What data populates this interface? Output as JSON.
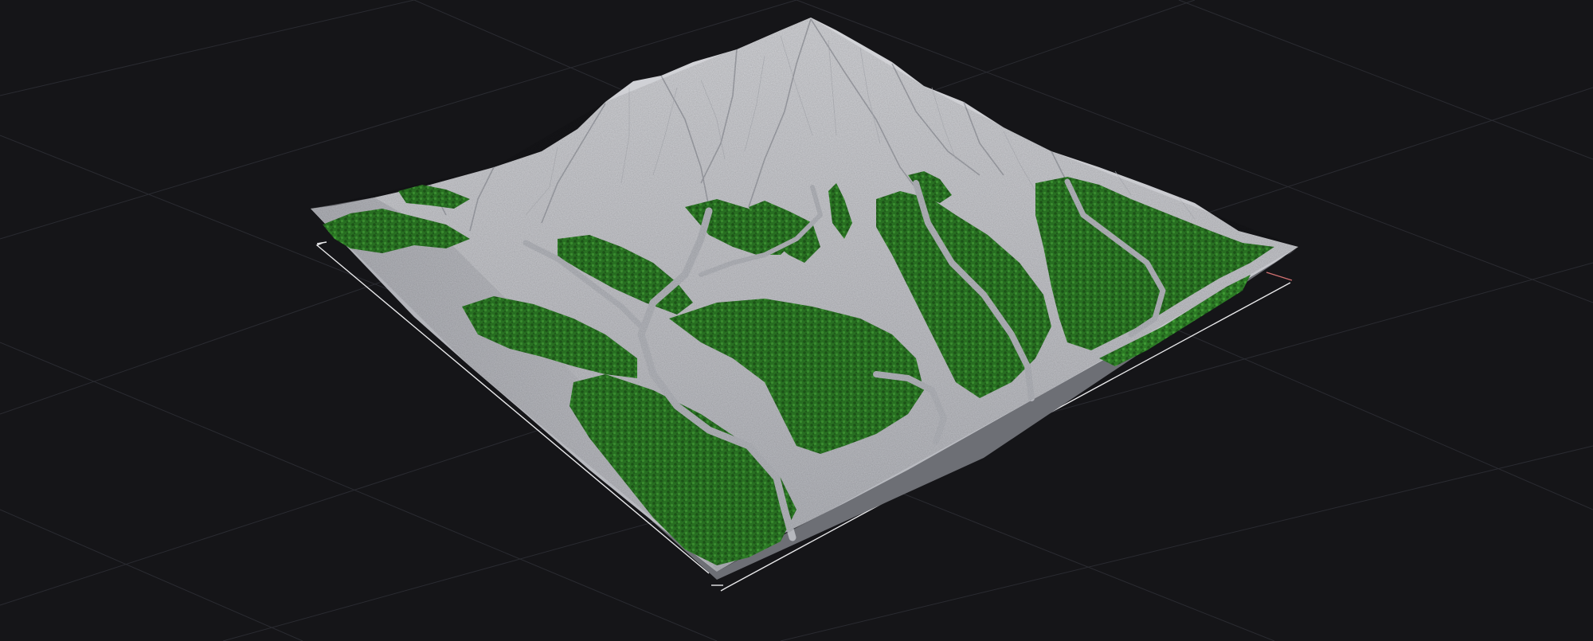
{
  "viewport": {
    "background_color": "#151518",
    "grid_color": "#2a2b31"
  },
  "terrain": {
    "snow_color": "#c9cacf",
    "snow_shadow_color": "#a2a4ab",
    "rock_color": "#8f9198",
    "forest_color": "#2c7a25",
    "forest_dark_color": "#1f5a1a",
    "forest_light_color": "#3f9a34",
    "river_color": "#b6b8be"
  },
  "bounds_gizmo": {
    "line_color": "#e8e8ea",
    "corner_accent_color": "#d07070"
  }
}
